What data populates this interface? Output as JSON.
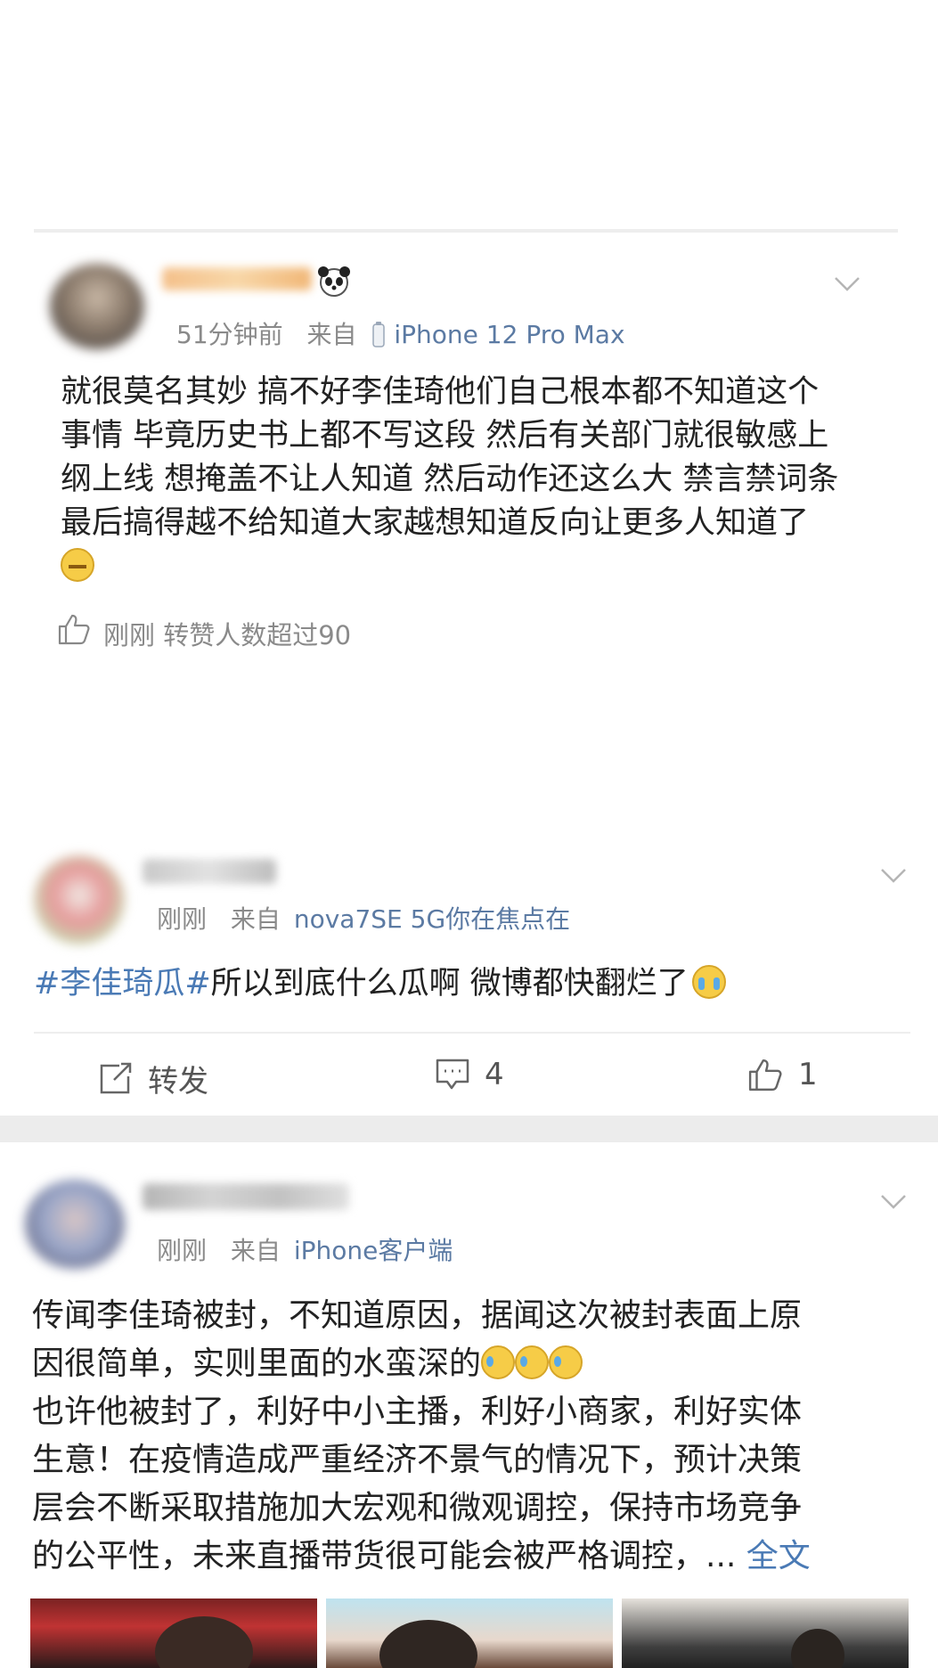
{
  "post1": {
    "time": "51分钟前",
    "from_label": "来自",
    "source": "iPhone 12 Pro Max",
    "text_lines": [
      "就很莫名其妙 搞不好李佳琦他们自己根本都不知道这个",
      "事情 毕竟历史书上都不写这段 然后有关部门就很敏感上",
      "纲上线 想掩盖不让人知道 然后动作还这么大 禁言禁词条",
      "最后搞得越不给知道大家越想知道反向让更多人知道了"
    ],
    "footer": "刚刚 转赞人数超过90"
  },
  "post2": {
    "time": "刚刚",
    "from_label": "来自",
    "source": "nova7SE 5G你在焦点在",
    "hashtag": "#李佳琦瓜#",
    "text": "所以到底什么瓜啊 微博都快翻烂了",
    "actions": {
      "repost": "转发",
      "comments": "4",
      "likes": "1"
    }
  },
  "post3": {
    "time": "刚刚",
    "from_label": "来自",
    "source": "iPhone客户端",
    "text_lines": [
      "传闻李佳琦被封，不知道原因，据闻这次被封表面上原",
      "因很简单，实则里面的水蛮深的",
      "也许他被封了，利好中小主播，利好小商家，利好实体",
      "生意！在疫情造成严重经济不景气的情况下，预计决策",
      "层会不断采取措施加大宏观和微观调控，保持市场竞争",
      "的公平性，未来直播带货很可能会被严格调控，..."
    ],
    "full_text_link": "全文"
  }
}
